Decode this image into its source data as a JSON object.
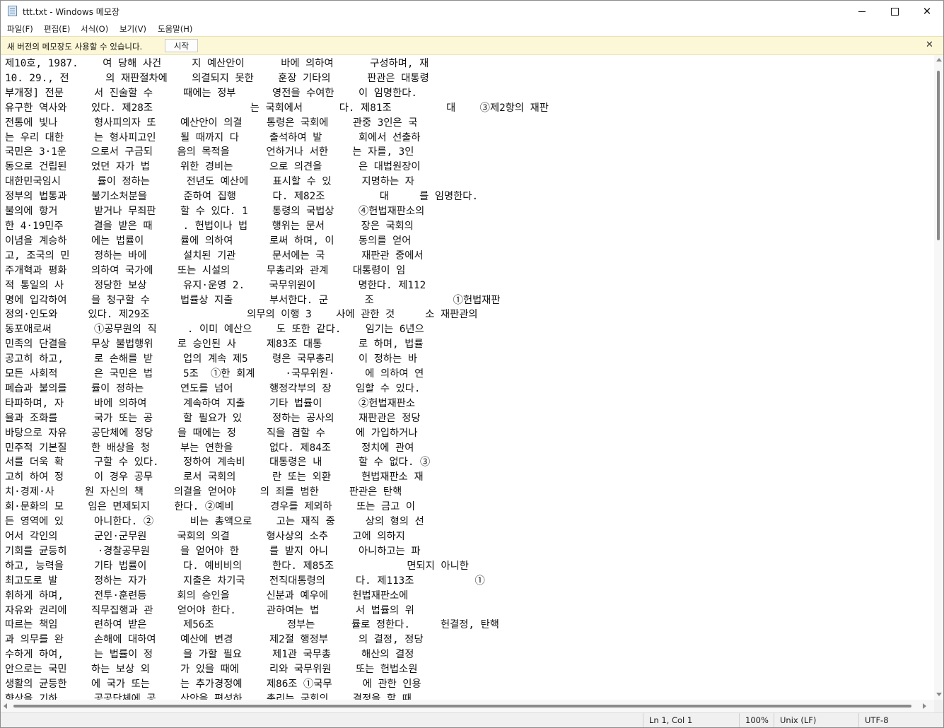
{
  "window": {
    "title": "ttt.txt - Windows 메모장"
  },
  "menu": [
    "파일(F)",
    "편집(E)",
    "서식(O)",
    "보기(V)",
    "도움말(H)"
  ],
  "infobar": {
    "message": "새 버전의 메모장도 사용할 수 있습니다.",
    "button_label": "시작",
    "close_glyph": "✕"
  },
  "window_controls": {
    "close_glyph": "✕"
  },
  "editor": {
    "lines": [
      "제10호, 1987.    여 당해 사건     지 예산안이      바에 의하여      구성하며, 재",
      "10. 29., 전      의 재판절차에    의결되지 못한    훈장 기타의      판관은 대통령",
      "부개정] 전문     서 진술할 수     때에는 정부      영전을 수여한    이 임명한다.",
      "유구한 역사와    있다. 제28조                는 국회에서      다. 제81조         대    ③제2항의 재판",
      "전통에 빛나      형사피의자 또    예산안이 의결    통령은 국회에    관중 3인은 국",
      "는 우리 대한     는 형사피고인    될 때까지 다     출석하여 발      회에서 선출하",
      "국민은 3·1운    으로서 구금되    음의 목적을      언하거나 서한    는 자를, 3인",
      "동으로 건립된    었던 자가 법     위한 경비는      으로 의견을      은 대법원장이",
      "대한민국임시      률이 정하는      전년도 예산에    표시할 수 있     지명하는 자",
      "정부의 법통과    불기소처분을      준하여 집행      다. 제82조         대     를 임명한다.",
      "불의에 항거      받거나 무죄판    할 수 있다. 1    통령의 국법상    ④헌법재판소의",
      "한 4·19민주     결을 받은 때     . 헌법이나 법    행위는 문서      장은 국회의",
      "이념을 계승하    에는 법률이      률에 의하여      로써 하며, 이    동의를 얻어",
      "고, 조국의 민    정하는 바에      설치된 기관      문서에는 국      재판관 중에서",
      "주개혁과 평화    의하여 국가에    또는 시설의      무총리와 관계    대통령이 임",
      "적 통일의 사     정당한 보상      유지·운영 2.    국무위원이       명한다. 제112",
      "명에 입각하여    을 청구할 수     법률상 지출      부서한다. 군      조             ①헌법재판",
      "정의·인도와     있다. 제29조                의무의 이행 3    사에 관한 것     소 재판관의",
      "동포애로써       ①공무원의 직     . 이미 예산으    도 또한 같다.    임기는 6년으",
      "민족의 단결을    무상 불법행위    로 승인된 사     제83조 대통      로 하며, 법률",
      "공고히 하고,     로 손해를 받     업의 계속 제5    령은 국무총리    이 정하는 바",
      "모든 사회적      은 국민은 법     5조  ①한 회계     ·국무위원·     에 의하여 연",
      "폐습과 불의를    률이 정하는      연도를 넘어      행정각부의 장    임할 수 있다.",
      "타파하며, 자     바에 의하여      계속하여 지출    기타 법률이      ②헌법재판소",
      "율과 조화를      국가 또는 공     할 필요가 있     정하는 공사의    재판관은 정당",
      "바탕으로 자유    공단체에 정당    을 때에는 정     직을 겸할 수     에 가입하거나",
      "민주적 기본질    한 배상을 청     부는 연한을      없다. 제84조     정치에 관여",
      "서를 더욱 확     구할 수 있다.    정하여 계속비    대통령은 내      할 수 없다. ③",
      "고히 하여 정     이 경우 공무     로서 국회의      란 또는 외환     헌법재판소 재",
      "치·경제·사     원 자신의 책     의결을 얻어야    의 죄를 범한     판관은 탄핵",
      "회·문화의 모    임은 면제되지    한다. ②예비      경우를 제외하    또는 금고 이",
      "든 영역에 있     아니한다. ②      비는 총액으로    고는 재직 중     상의 형의 선",
      "어서 각인의      군인·군무원     국회의 의결      형사상의 소추    고에 의하지",
      "기회를 균등히     ·경찰공무원     을 얻어야 한     를 받지 아니     아니하고는 파",
      "하고, 능력을     기타 법률이      다. 예비비의     한다. 제85조            면되지 아니한",
      "최고도로 발      정하는 자가      지출은 차기국    전직대통령의     다. 제113조          ①",
      "휘하게 하며,     전투·훈련등     회의 승인을      신분과 예우에    헌법재판소에",
      "자유와 권리에    직무집행과 관    얻어야 한다.     관하여는 법      서 법률의 위",
      "따르는 책임      련하여 받은      제56조            정부는      률로 정한다.     헌결정, 탄핵",
      "과 의무를 완     손해에 대하여    예산에 변경      제2절 행정부     의 결정, 정당",
      "수하게 하여,     는 법률이 정     을 가할 필요     제1관 국무총     해산의 결정",
      "안으로는 국민    하는 보상 외     가 있을 때에     리와 국무위원    또는 헌법소원",
      "생활의 균등한    에 국가 또는     는 추가경정예    제86조 ①국무     에 관한 인용",
      "향상을 기하      공공단체에 공    산안을 편성하    총리는 국회의    결정을 할 때"
    ]
  },
  "statusbar": {
    "position": "Ln 1, Col 1",
    "zoom": "100%",
    "line_ending": "Unix (LF)",
    "encoding": "UTF-8"
  }
}
